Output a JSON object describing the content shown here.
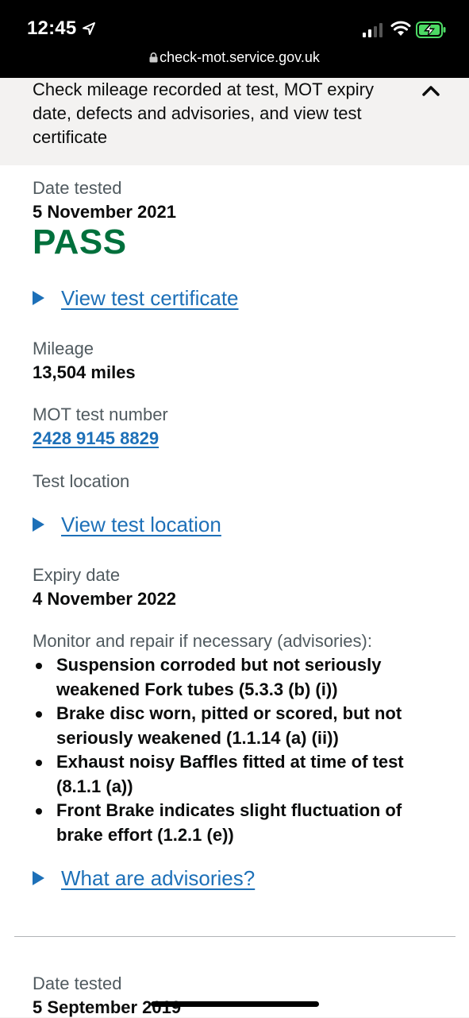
{
  "status_bar": {
    "time": "12:45",
    "url": "check-mot.service.gov.uk"
  },
  "summary": {
    "text": "Check mileage recorded at test, MOT expiry date, defects and advisories, and view test certificate"
  },
  "test1": {
    "date_label": "Date tested",
    "date": "5 November 2021",
    "result": "PASS",
    "view_certificate": "View test certificate",
    "mileage_label": "Mileage",
    "mileage": "13,504 miles",
    "test_number_label": "MOT test number",
    "test_number": "2428 9145 8829",
    "location_label": "Test location",
    "view_location": "View test location",
    "expiry_label": "Expiry date",
    "expiry": "4 November 2022",
    "advisories_label": "Monitor and repair if necessary (advisories):",
    "advisories": [
      "Suspension corroded but not seriously weakened Fork tubes (5.3.3 (b) (i))",
      "Brake disc worn, pitted or scored, but not seriously weakened (1.1.14 (a) (ii))",
      "Exhaust noisy Baffles fitted at time of test (8.1.1 (a))",
      "Front Brake indicates slight fluctuation of brake effort (1.2.1 (e))"
    ],
    "what_are_advisories": "What are advisories?"
  },
  "test2": {
    "date_label": "Date tested",
    "date": "5 September 2019"
  },
  "colors": {
    "pass_green": "#00703c",
    "link_blue": "#1d70b8",
    "secondary_text": "#505a5f"
  }
}
